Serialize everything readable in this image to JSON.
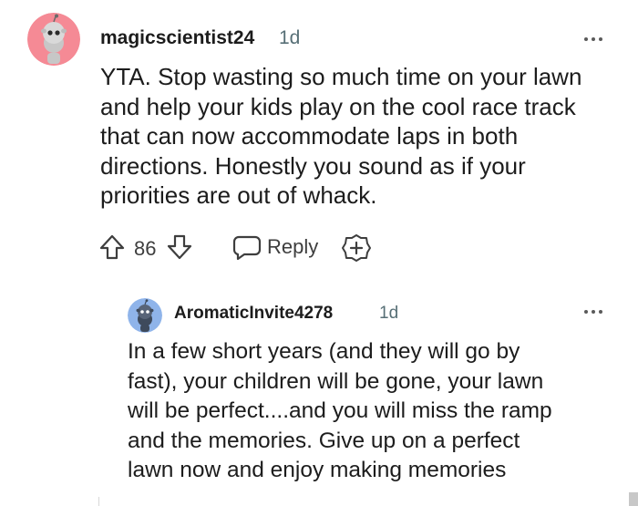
{
  "comments": [
    {
      "username": "magicscientist24",
      "age": "1d",
      "avatar_color": "#f58a95",
      "body": "YTA. Stop wasting so much time on your lawn\nand help your kids play on the cool race track\nthat can now accommodate laps in both\ndirections. Honestly you sound as if your\npriorities are out of whack.",
      "upvotes": "86",
      "reply_label": "Reply"
    },
    {
      "username": "AromaticInvite4278",
      "age": "1d",
      "avatar_color": "#8fb4ea",
      "body": "In a few short years (and they will go by\nfast), your children will be gone, your lawn\nwill be perfect....and you will miss the ramp\nand the memories. Give up on a perfect\nlawn now and enjoy making memories"
    }
  ],
  "icons": {
    "avatar": "snoo-avatar-icon",
    "more": "more-options-icon",
    "upvote": "upvote-arrow-icon",
    "downvote": "downvote-arrow-icon",
    "reply": "speech-bubble-icon",
    "award": "award-plus-icon"
  }
}
